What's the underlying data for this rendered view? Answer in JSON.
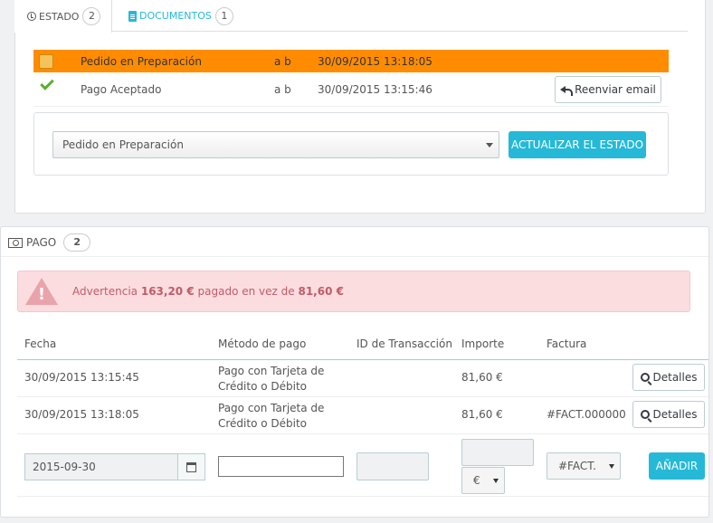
{
  "tabs": [
    {
      "label": "Estado",
      "count": "2"
    },
    {
      "label": "Documentos",
      "count": "1"
    }
  ],
  "history": [
    {
      "state": "Pedido en Preparación",
      "employee": "a b",
      "date": "30/09/2015 13:18:05",
      "icon": "package-icon"
    },
    {
      "state": "Pago Aceptado",
      "employee": "a b",
      "date": "30/09/2015 13:15:46",
      "icon": "check-icon",
      "action": "Reenviar email"
    }
  ],
  "update": {
    "selected_state": "Pedido en Preparación",
    "button": "Actualizar el estado"
  },
  "payment": {
    "title": "Pago",
    "count": "2",
    "warning": {
      "prefix": "Advertencia",
      "paid": "163,20 €",
      "middle": "pagado en vez de",
      "expected": "81,60 €"
    },
    "headers": [
      "Fecha",
      "Método de pago",
      "ID de Transacción",
      "Importe",
      "Factura"
    ],
    "rows": [
      {
        "date": "30/09/2015 13:15:45",
        "method_1": "Pago con Tarjeta de",
        "method_2": "Crédito o Débito",
        "transaction": "",
        "amount": "81,60 €",
        "invoice": "",
        "details": "Detalles"
      },
      {
        "date": "30/09/2015 13:18:05",
        "method_1": "Pago con Tarjeta de",
        "method_2": "Crédito o Débito",
        "transaction": "",
        "amount": "81,60 €",
        "invoice": "#FACT.000000",
        "details": "Detalles"
      }
    ],
    "form": {
      "date": "2015-09-30",
      "currency": "€",
      "invoice": "#FACT.",
      "add_button": "Añadir"
    }
  },
  "colors": {
    "accent": "#25b9d7",
    "current_state": "#ff8c00",
    "alert_bg": "#fbdde0",
    "alert_text": "#c05c67",
    "check": "#5bae32"
  }
}
